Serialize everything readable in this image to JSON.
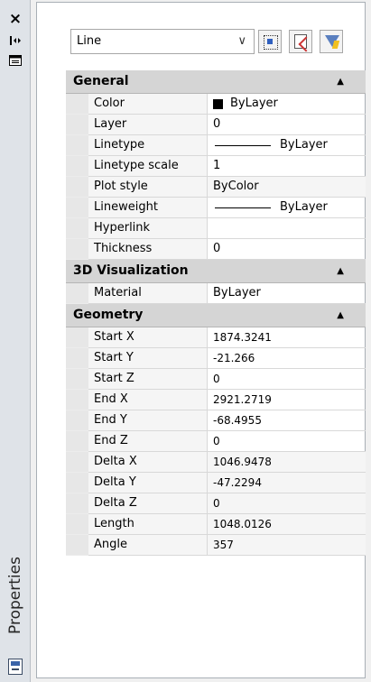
{
  "panel_title": "Properties",
  "object_select": {
    "value": "Line"
  },
  "icons": {
    "close": "close-icon",
    "autohide": "autohide-icon",
    "menu": "properties-menu-icon"
  },
  "sections": [
    {
      "title": "General",
      "rows": [
        {
          "label": "Color",
          "value": "ByLayer",
          "kind": "color"
        },
        {
          "label": "Layer",
          "value": "0"
        },
        {
          "label": "Linetype",
          "value": "ByLayer",
          "kind": "line"
        },
        {
          "label": "Linetype scale",
          "value": "1"
        },
        {
          "label": "Plot style",
          "value": "ByColor",
          "shaded": true
        },
        {
          "label": "Lineweight",
          "value": "ByLayer",
          "kind": "line"
        },
        {
          "label": "Hyperlink",
          "value": ""
        },
        {
          "label": "Thickness",
          "value": "0"
        }
      ]
    },
    {
      "title": "3D Visualization",
      "rows": [
        {
          "label": "Material",
          "value": "ByLayer"
        }
      ]
    },
    {
      "title": "Geometry",
      "rows": [
        {
          "label": "Start X",
          "value": "1874.3241"
        },
        {
          "label": "Start Y",
          "value": "-21.266"
        },
        {
          "label": "Start Z",
          "value": "0"
        },
        {
          "label": "End X",
          "value": "2921.2719"
        },
        {
          "label": "End Y",
          "value": "-68.4955"
        },
        {
          "label": "End Z",
          "value": "0"
        },
        {
          "label": "Delta X",
          "value": "1046.9478",
          "shaded": true
        },
        {
          "label": "Delta Y",
          "value": "-47.2294",
          "shaded": true
        },
        {
          "label": "Delta Z",
          "value": "0",
          "shaded": true
        },
        {
          "label": "Length",
          "value": "1048.0126",
          "shaded": true
        },
        {
          "label": "Angle",
          "value": "357",
          "shaded": true
        }
      ]
    }
  ]
}
